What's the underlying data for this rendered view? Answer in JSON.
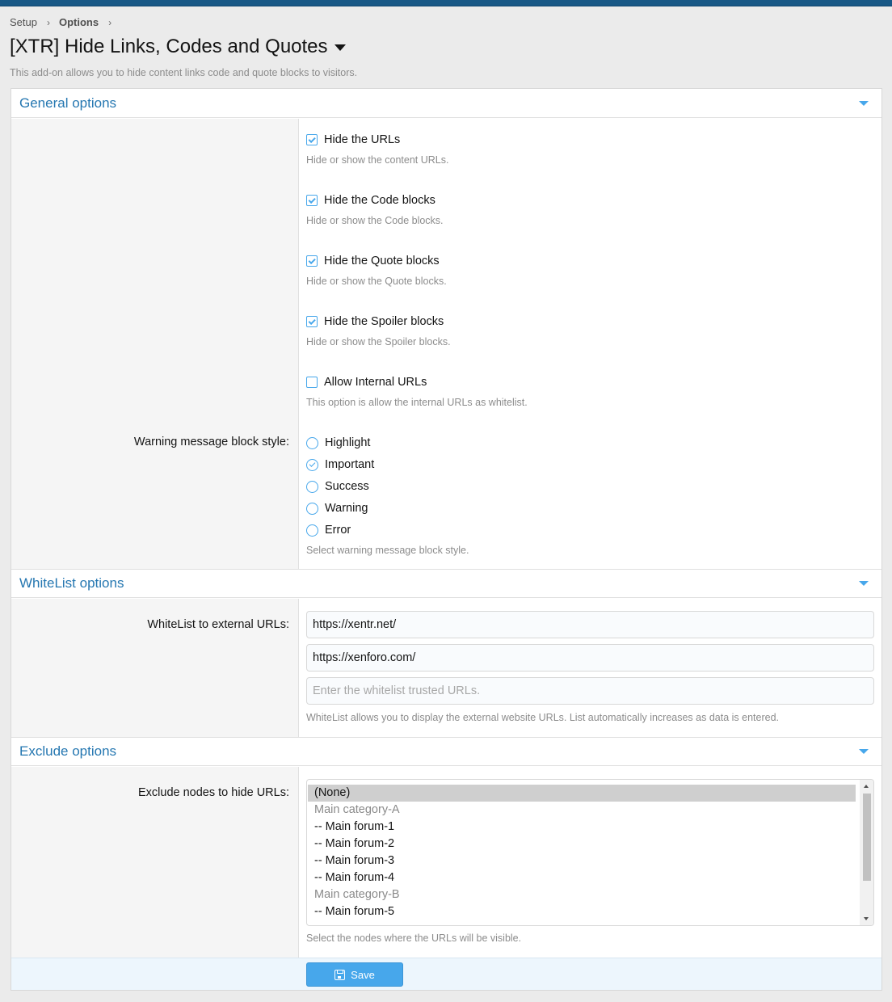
{
  "breadcrumb": {
    "setup": "Setup",
    "options": "Options"
  },
  "page": {
    "title": "[XTR] Hide Links, Codes and Quotes",
    "description": "This add-on allows you to hide content links code and quote blocks to visitors."
  },
  "general": {
    "title": "General options",
    "checkboxes": [
      {
        "label": "Hide the URLs",
        "hint": "Hide or show the content URLs.",
        "checked": true
      },
      {
        "label": "Hide the Code blocks",
        "hint": "Hide or show the Code blocks.",
        "checked": true
      },
      {
        "label": "Hide the Quote blocks",
        "hint": "Hide or show the Quote blocks.",
        "checked": true
      },
      {
        "label": "Hide the Spoiler blocks",
        "hint": "Hide or show the Spoiler blocks.",
        "checked": true
      },
      {
        "label": "Allow Internal URLs",
        "hint": "This option is allow the internal URLs as whitelist.",
        "checked": false
      }
    ],
    "style_label": "Warning message block style:",
    "style_options": [
      "Highlight",
      "Important",
      "Success",
      "Warning",
      "Error"
    ],
    "style_selected": "Important",
    "style_hint": "Select warning message block style."
  },
  "whitelist": {
    "title": "WhiteList options",
    "label": "WhiteList to external URLs:",
    "urls": [
      "https://xentr.net/",
      "https://xenforo.com/"
    ],
    "placeholder": "Enter the whitelist trusted URLs.",
    "hint": "WhiteList allows you to display the external website URLs. List automatically increases as data is entered."
  },
  "exclude": {
    "title": "Exclude options",
    "label": "Exclude nodes to hide URLs:",
    "nodes": [
      {
        "text": "(None)",
        "category": false,
        "selected": true
      },
      {
        "text": "Main category-A",
        "category": true,
        "selected": false
      },
      {
        "text": "-- Main forum-1",
        "category": false,
        "selected": false
      },
      {
        "text": "-- Main forum-2",
        "category": false,
        "selected": false
      },
      {
        "text": "-- Main forum-3",
        "category": false,
        "selected": false
      },
      {
        "text": "-- Main forum-4",
        "category": false,
        "selected": false
      },
      {
        "text": "Main category-B",
        "category": true,
        "selected": false
      },
      {
        "text": "-- Main forum-5",
        "category": false,
        "selected": false
      }
    ],
    "hint": "Select the nodes where the URLs will be visible."
  },
  "footer": {
    "save_label": "Save"
  },
  "colors": {
    "accent": "#47a7eb",
    "header_text": "#2577b1",
    "top_bar": "#185886"
  }
}
